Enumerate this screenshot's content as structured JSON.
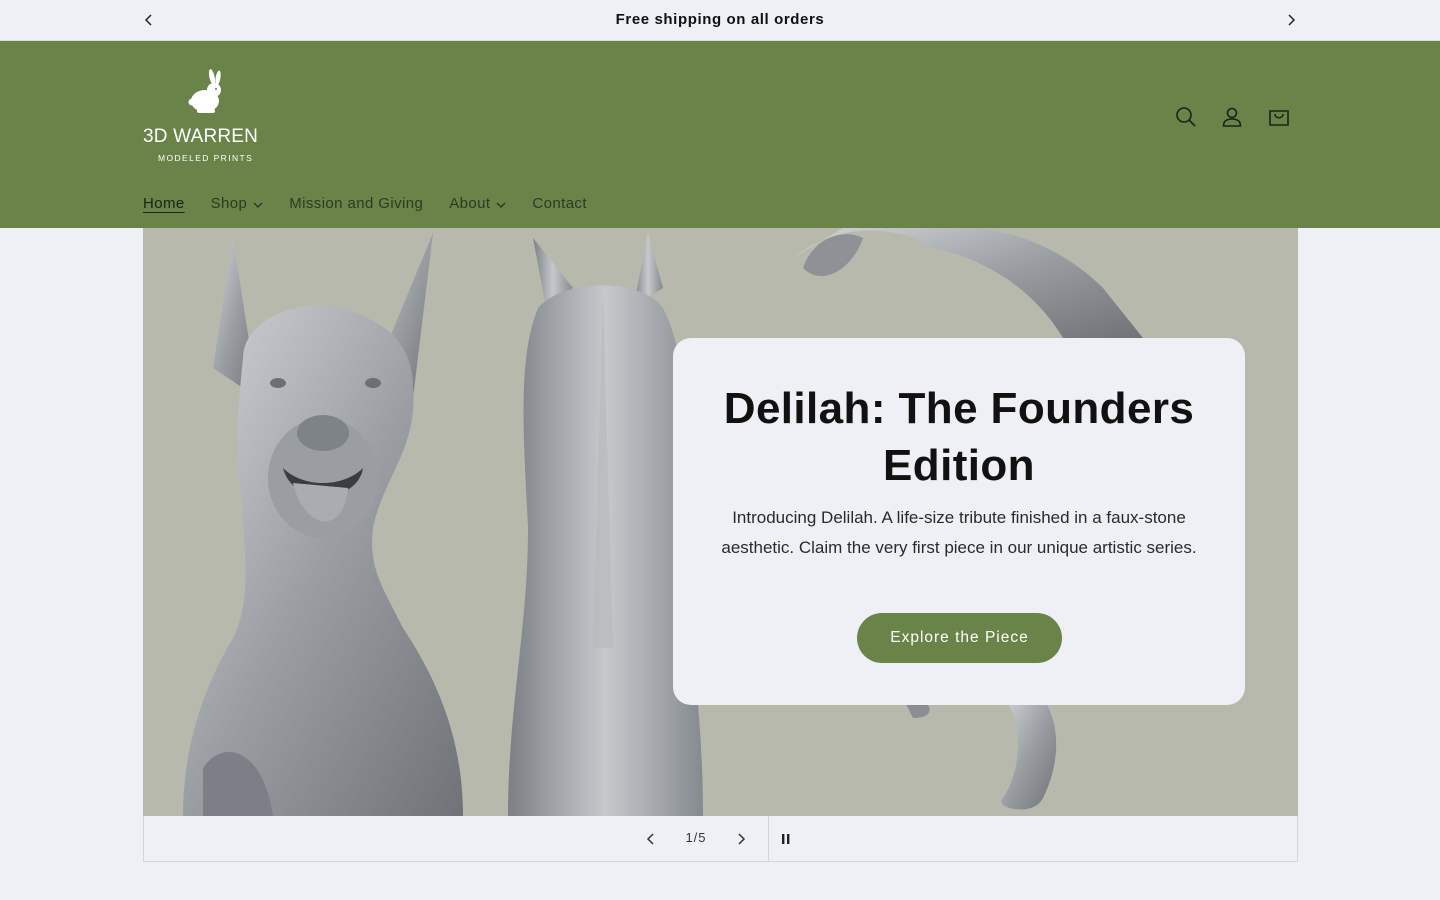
{
  "announcement": {
    "text": "Free shipping on all orders",
    "prev_icon": "chevron-left-icon",
    "next_icon": "chevron-right-icon"
  },
  "header": {
    "logo": {
      "name": "3D WARREN",
      "tagline": "MODELED PRINTS",
      "icon": "rabbit-icon"
    },
    "icons": [
      "search-icon",
      "account-icon",
      "cart-icon"
    ],
    "nav": [
      {
        "label": "Home",
        "active": true,
        "dropdown": false
      },
      {
        "label": "Shop",
        "active": false,
        "dropdown": true
      },
      {
        "label": "Mission and Giving",
        "active": false,
        "dropdown": false
      },
      {
        "label": "About",
        "active": false,
        "dropdown": true
      },
      {
        "label": "Contact",
        "active": false,
        "dropdown": false
      }
    ]
  },
  "hero": {
    "title": "Delilah: The Founders Edition",
    "text": "Introducing Delilah. A life-size tribute finished in a faux-stone aesthetic. Claim the very first piece in our unique artistic series.",
    "button_label": "Explore the Piece"
  },
  "slider": {
    "counter": "1/5",
    "current": 1,
    "total": 5
  },
  "colors": {
    "brand_green": "#6a8349",
    "background": "#eef0f5",
    "hero_backdrop": "#b8b9ad"
  }
}
